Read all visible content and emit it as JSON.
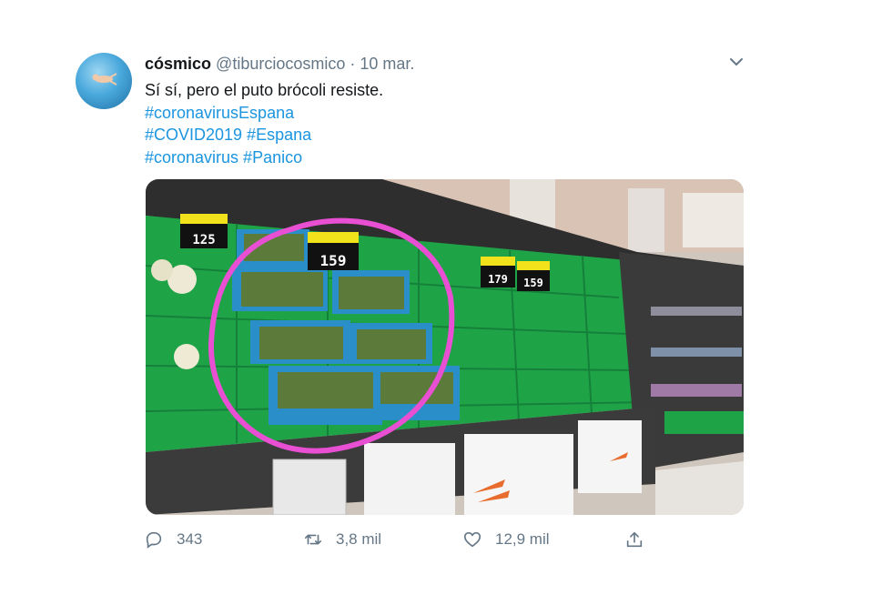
{
  "tweet": {
    "author_name": "cósmico",
    "handle": "@tiburciocosmico",
    "separator": "·",
    "date": "10 mar.",
    "lines": [
      "Sí sí, pero el puto brócoli resiste.",
      "#coronavirusEspana",
      "#COVID2019 #Espana",
      "#coronavirus #Panico"
    ],
    "icons": {
      "menu": "chevron-down-icon",
      "reply": "reply-icon",
      "retweet": "retweet-icon",
      "like": "heart-icon",
      "share": "share-icon"
    },
    "accent_color": "#1b95e0"
  },
  "photo": {
    "price_tags": [
      "125",
      "159",
      "179",
      "159"
    ],
    "highlight_color": "#e84fd3"
  },
  "actions": {
    "replies": "343",
    "retweets": "3,8 mil",
    "likes": "12,9 mil"
  }
}
